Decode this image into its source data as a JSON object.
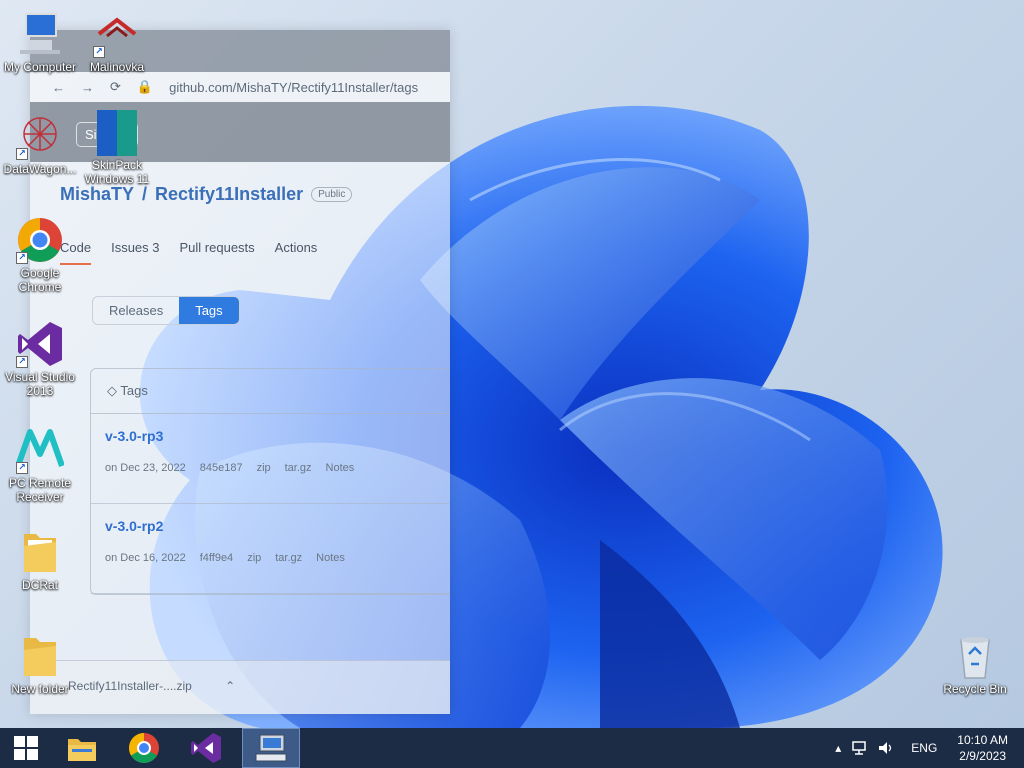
{
  "desktop": {
    "icons": [
      {
        "id": "my-computer",
        "label": "My Computer"
      },
      {
        "id": "malinovka",
        "label": "Malinovka"
      },
      {
        "id": "datawagon",
        "label": "DataWagon..."
      },
      {
        "id": "skinpack",
        "label": "SkinPack Windows 11"
      },
      {
        "id": "chrome",
        "label": "Google Chrome"
      },
      {
        "id": "visual-studio",
        "label": "Visual Studio 2013"
      },
      {
        "id": "pc-remote",
        "label": "PC Remote Receiver"
      },
      {
        "id": "dcrat",
        "label": "DCRat"
      },
      {
        "id": "new-folder",
        "label": "New folder"
      },
      {
        "id": "recycle-bin",
        "label": "Recycle Bin"
      }
    ]
  },
  "browser": {
    "url": "github.com/MishaTY/Rectify11Installer/tags",
    "signup": "Sign up",
    "owner": "MishaTY",
    "repo": "Rectify11Installer",
    "visibility": "Public",
    "tabs": {
      "code": "Code",
      "issues": "Issues",
      "issues_count": "3",
      "pulls": "Pull requests",
      "actions": "Actions"
    },
    "subtabs": {
      "releases": "Releases",
      "tags": "Tags"
    },
    "tags_header": "Tags",
    "tags": [
      {
        "name": "v-3.0-rp3",
        "date": "on Dec 23, 2022",
        "commit": "845e187",
        "zip": "zip",
        "targz": "tar.gz",
        "notes": "Notes"
      },
      {
        "name": "v-3.0-rp2",
        "date": "on Dec 16, 2022",
        "commit": "f4ff9e4",
        "zip": "zip",
        "targz": "tar.gz",
        "notes": "Notes"
      }
    ],
    "download": "Rectify11Installer-....zip"
  },
  "taskbar": {
    "language": "ENG",
    "time": "10:10 AM",
    "date": "2/9/2023"
  },
  "colors": {
    "taskbar": "#1c2c44",
    "accent": "#1565ff"
  }
}
